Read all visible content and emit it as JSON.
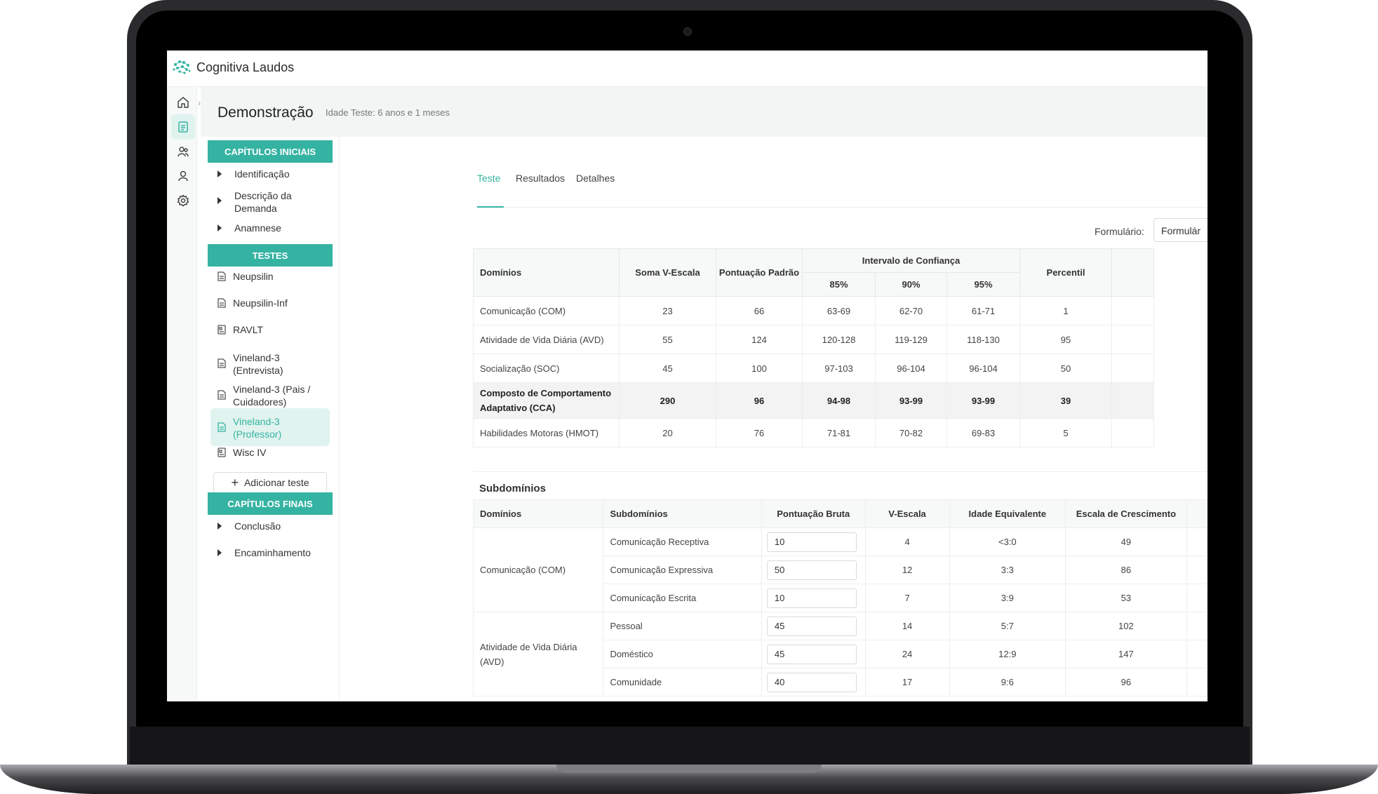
{
  "app": {
    "title": "Cognitiva Laudos"
  },
  "header": {
    "title": "Demonstração",
    "subtitle": "Idade Teste: 6 anos e 1 meses"
  },
  "rail": [
    {
      "icon": "home-icon"
    },
    {
      "icon": "report-icon",
      "active": true
    },
    {
      "icon": "patients-icon"
    },
    {
      "icon": "user-icon"
    },
    {
      "icon": "gear-icon"
    }
  ],
  "sidebar": {
    "initial_heading": "CAPÍTULOS INICIAIS",
    "initial_items": [
      "Identificação",
      "Descrição da Demanda",
      "Anamnese"
    ],
    "tests_heading": "TESTES",
    "tests": [
      {
        "label": "Neupsilin"
      },
      {
        "label": "Neupsilin-Inf"
      },
      {
        "label": "RAVLT"
      },
      {
        "label": "Vineland-3 (Entrevista)"
      },
      {
        "label": "Vineland-3 (Pais / Cuidadores)"
      },
      {
        "label": "Vineland-3 (Professor)",
        "active": true
      },
      {
        "label": "Wisc IV"
      }
    ],
    "add_test": "Adicionar teste",
    "final_heading": "CAPÍTULOS FINAIS",
    "final_items": [
      "Conclusão",
      "Encaminhamento"
    ]
  },
  "tabs": [
    "Teste",
    "Resultados",
    "Detalhes"
  ],
  "form": {
    "label": "Formulário:",
    "value": "Formulár"
  },
  "main_table": {
    "headers": {
      "dominios": "Domínios",
      "soma": "Soma V-Escala",
      "padrao": "Pontuação Padrão",
      "intervalo": "Intervalo de Confiança",
      "ic85": "85%",
      "ic90": "90%",
      "ic95": "95%",
      "percentil": "Percentil"
    },
    "rows": [
      {
        "dom": "Comunicação (COM)",
        "soma": "23",
        "padrao": "66",
        "ic85": "63-69",
        "ic90": "62-70",
        "ic95": "61-71",
        "perc": "1"
      },
      {
        "dom": "Atividade de Vida Diária (AVD)",
        "soma": "55",
        "padrao": "124",
        "ic85": "120-128",
        "ic90": "119-129",
        "ic95": "118-130",
        "perc": "95"
      },
      {
        "dom": "Socialização (SOC)",
        "soma": "45",
        "padrao": "100",
        "ic85": "97-103",
        "ic90": "96-104",
        "ic95": "96-104",
        "perc": "50"
      },
      {
        "dom": "Composto de Comportamento Adaptativo (CCA)",
        "soma": "290",
        "padrao": "96",
        "ic85": "94-98",
        "ic90": "93-99",
        "ic95": "93-99",
        "perc": "39"
      },
      {
        "dom": "Habilidades Motoras (HMOT)",
        "soma": "20",
        "padrao": "76",
        "ic85": "71-81",
        "ic90": "70-82",
        "ic95": "69-83",
        "perc": "5"
      }
    ]
  },
  "subdominios": {
    "title": "Subdomínios",
    "headers": {
      "dominios": "Domínios",
      "subdominios": "Subdomínios",
      "bruta": "Pontuação Bruta",
      "vescala": "V-Escala",
      "idade": "Idade Equivalente",
      "escala": "Escala de Crescimento"
    },
    "groups": [
      {
        "dom": "Comunicação (COM)",
        "rows": [
          {
            "sub": "Comunicação Receptiva",
            "bruta": "10",
            "v": "4",
            "idade": "<3:0",
            "esc": "49"
          },
          {
            "sub": "Comunicação Expressiva",
            "bruta": "50",
            "v": "12",
            "idade": "3:3",
            "esc": "86"
          },
          {
            "sub": "Comunicação Escrita",
            "bruta": "10",
            "v": "7",
            "idade": "3:9",
            "esc": "53"
          }
        ]
      },
      {
        "dom": "Atividade de Vida Diária (AVD)",
        "rows": [
          {
            "sub": "Pessoal",
            "bruta": "45",
            "v": "14",
            "idade": "5:7",
            "esc": "102"
          },
          {
            "sub": "Doméstico",
            "bruta": "45",
            "v": "24",
            "idade": "12:9",
            "esc": "147"
          },
          {
            "sub": "Comunidade",
            "bruta": "40",
            "v": "17",
            "idade": "9:6",
            "esc": "96"
          }
        ]
      }
    ]
  },
  "colors": {
    "accent": "#35b3a2",
    "accent_light": "#e0f3ef"
  }
}
